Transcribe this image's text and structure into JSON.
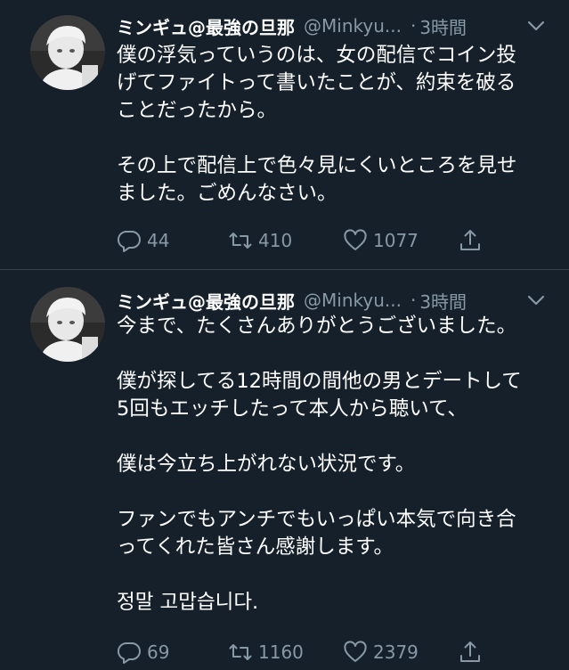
{
  "tweets": [
    {
      "author": {
        "name": "ミンギュ@最強の旦那",
        "handle": "@Minkyu...",
        "dot": "·",
        "time": "3時間"
      },
      "paragraphs": [
        [
          "僕の浮気っていうのは、女の配信でコイン投",
          "げてファイトって書いたことが、約束を破る",
          "ことだったから。"
        ],
        [
          "その上で配信上で色々見にくいところを見せ",
          "ました。ごめんなさい。"
        ]
      ],
      "counts": {
        "replies": "44",
        "retweets": "410",
        "likes": "1077"
      }
    },
    {
      "author": {
        "name": "ミンギュ@最強の旦那",
        "handle": "@Minkyu...",
        "dot": "·",
        "time": "3時間"
      },
      "paragraphs": [
        [
          "今まで、たくさんありがとうございました。"
        ],
        [
          "僕が探してる12時間の間他の男とデートして",
          "5回もエッチしたって本人から聴いて、"
        ],
        [
          "僕は今立ち上がれない状況です。"
        ],
        [
          "ファンでもアンチでもいっぱい本気で向き合",
          "ってくれた皆さん感謝します。"
        ],
        [
          "정말 고맙습니다."
        ]
      ],
      "counts": {
        "replies": "69",
        "retweets": "1160",
        "likes": "2379"
      }
    }
  ],
  "icons": {
    "reply": "reply-icon",
    "retweet": "retweet-icon",
    "like": "heart-icon",
    "share": "share-icon",
    "menu": "chevron-down-icon",
    "avatar": "avatar"
  },
  "colors": {
    "background": "#15202b",
    "divider": "#38444d",
    "text": "#ffffff",
    "secondary": "#8899a6"
  }
}
